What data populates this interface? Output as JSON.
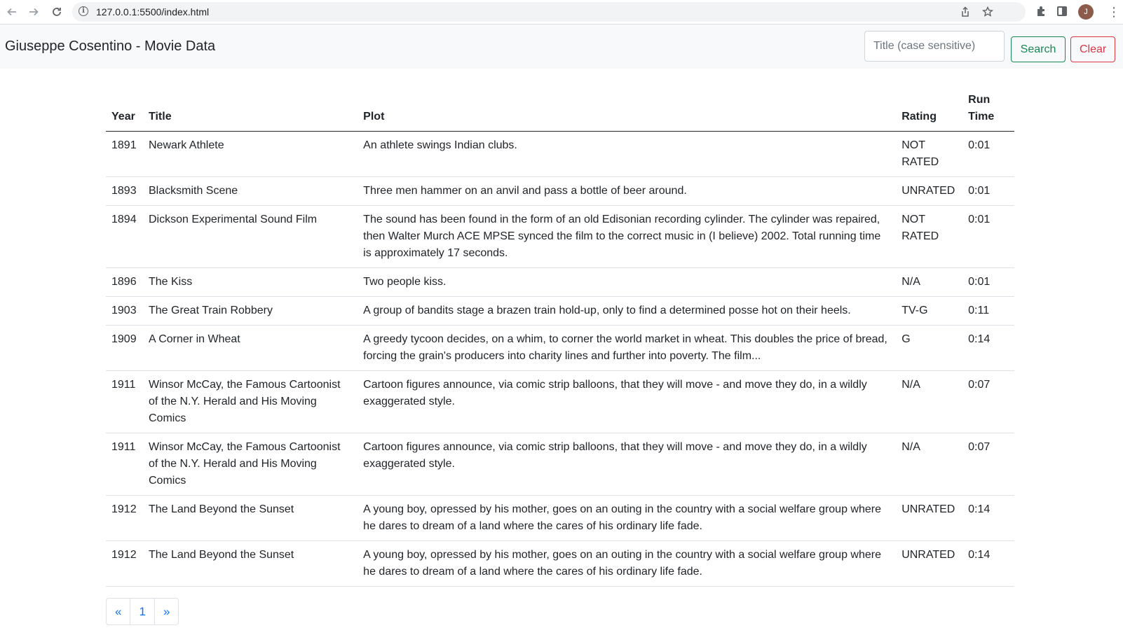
{
  "browser": {
    "url": "127.0.0.1:5500/index.html",
    "avatar_initial": "J"
  },
  "navbar": {
    "brand": "Giuseppe Cosentino - Movie Data",
    "search_placeholder": "Title (case sensitive)",
    "search_label": "Search",
    "clear_label": "Clear"
  },
  "table": {
    "headers": {
      "year": "Year",
      "title": "Title",
      "plot": "Plot",
      "rating": "Rating",
      "runtime": "Run Time"
    },
    "rows": [
      {
        "year": "1891",
        "title": "Newark Athlete",
        "plot": "An athlete swings Indian clubs.",
        "rating": "NOT RATED",
        "runtime": "0:01"
      },
      {
        "year": "1893",
        "title": "Blacksmith Scene",
        "plot": "Three men hammer on an anvil and pass a bottle of beer around.",
        "rating": "UNRATED",
        "runtime": "0:01"
      },
      {
        "year": "1894",
        "title": "Dickson Experimental Sound Film",
        "plot": "The sound has been found in the form of an old Edisonian recording cylinder. The cylinder was repaired, then Walter Murch ACE MPSE synced the film to the correct music in (I believe) 2002. Total running time is approximately 17 seconds.",
        "rating": "NOT RATED",
        "runtime": "0:01"
      },
      {
        "year": "1896",
        "title": "The Kiss",
        "plot": "Two people kiss.",
        "rating": "N/A",
        "runtime": "0:01"
      },
      {
        "year": "1903",
        "title": "The Great Train Robbery",
        "plot": "A group of bandits stage a brazen train hold-up, only to find a determined posse hot on their heels.",
        "rating": "TV-G",
        "runtime": "0:11"
      },
      {
        "year": "1909",
        "title": "A Corner in Wheat",
        "plot": "A greedy tycoon decides, on a whim, to corner the world market in wheat. This doubles the price of bread, forcing the grain's producers into charity lines and further into poverty. The film...",
        "rating": "G",
        "runtime": "0:14"
      },
      {
        "year": "1911",
        "title": "Winsor McCay, the Famous Cartoonist of the N.Y. Herald and His Moving Comics",
        "plot": "Cartoon figures announce, via comic strip balloons, that they will move - and move they do, in a wildly exaggerated style.",
        "rating": "N/A",
        "runtime": "0:07"
      },
      {
        "year": "1911",
        "title": "Winsor McCay, the Famous Cartoonist of the N.Y. Herald and His Moving Comics",
        "plot": "Cartoon figures announce, via comic strip balloons, that they will move - and move they do, in a wildly exaggerated style.",
        "rating": "N/A",
        "runtime": "0:07"
      },
      {
        "year": "1912",
        "title": "The Land Beyond the Sunset",
        "plot": "A young boy, opressed by his mother, goes on an outing in the country with a social welfare group where he dares to dream of a land where the cares of his ordinary life fade.",
        "rating": "UNRATED",
        "runtime": "0:14"
      },
      {
        "year": "1912",
        "title": "The Land Beyond the Sunset",
        "plot": "A young boy, opressed by his mother, goes on an outing in the country with a social welfare group where he dares to dream of a land where the cares of his ordinary life fade.",
        "rating": "UNRATED",
        "runtime": "0:14"
      }
    ]
  },
  "pagination": {
    "prev": "«",
    "current": "1",
    "next": "»"
  },
  "icons": {
    "back": "back-arrow-icon",
    "forward": "forward-arrow-icon",
    "reload": "reload-icon",
    "info": "info-icon",
    "share": "share-icon",
    "star": "star-icon",
    "extensions": "puzzle-icon",
    "sidepanel": "side-panel-icon",
    "menu": "kebab-menu-icon"
  }
}
